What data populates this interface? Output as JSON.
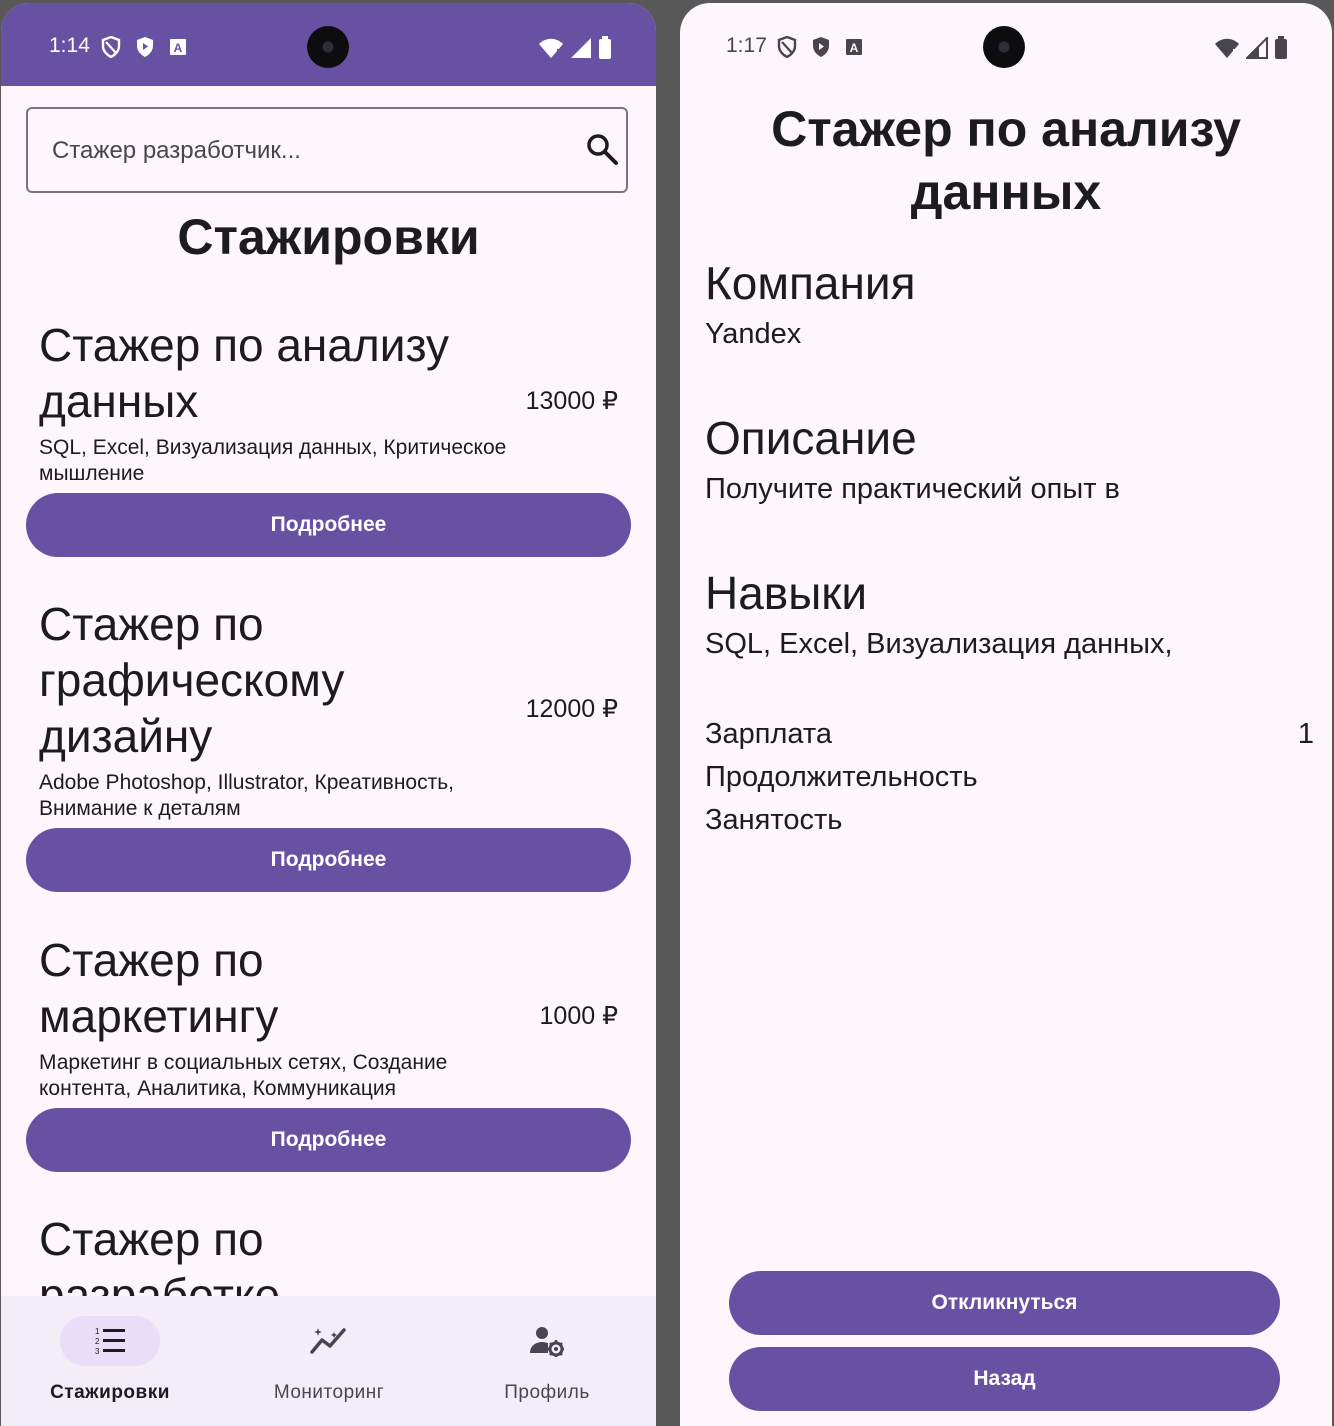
{
  "left": {
    "status": {
      "time": "1:14"
    },
    "search": {
      "placeholder": "Стажер разработчик..."
    },
    "title": "Стажировки",
    "cards": [
      {
        "title": "Стажер по анализу данных",
        "price": "13000 ₽",
        "skills": "SQL, Excel, Визуализация данных, Критическое мышление",
        "button": "Подробнее"
      },
      {
        "title": "Стажер по графическому дизайну",
        "price": "12000 ₽",
        "skills": "Adobe Photoshop, Illustrator, Креативность, Внимание к деталям",
        "button": "Подробнее"
      },
      {
        "title": "Стажер по маркетингу",
        "price": "1000 ₽",
        "skills": "Маркетинг в социальных сетях, Создание контента, Аналитика, Коммуникация",
        "button": "Подробнее"
      },
      {
        "title": "Стажер по разработке"
      }
    ],
    "nav": [
      {
        "label": "Стажировки",
        "icon": "list-numbered-icon",
        "active": true
      },
      {
        "label": "Мониторинг",
        "icon": "analytics-icon",
        "active": false
      },
      {
        "label": "Профиль",
        "icon": "manage-accounts-icon",
        "active": false
      }
    ]
  },
  "right": {
    "status": {
      "time": "1:17"
    },
    "title": "Стажер по анализу данных",
    "company": {
      "heading": "Компания",
      "value": "Yandex"
    },
    "description": {
      "heading": "Описание",
      "value": "Получите практический опыт в"
    },
    "skills": {
      "heading": "Навыки",
      "value": "SQL, Excel, Визуализация данных,"
    },
    "info": {
      "salary_label": "Зарплата",
      "salary_value": "1",
      "duration_label": "Продолжительность",
      "employment_label": "Занятость"
    },
    "apply_button": "Откликнуться",
    "back_button": "Назад"
  },
  "colors": {
    "primary": "#6651a3",
    "background": "#fdf7fd",
    "nav_background": "#f3edf7",
    "nav_indicator": "#e8def8"
  }
}
